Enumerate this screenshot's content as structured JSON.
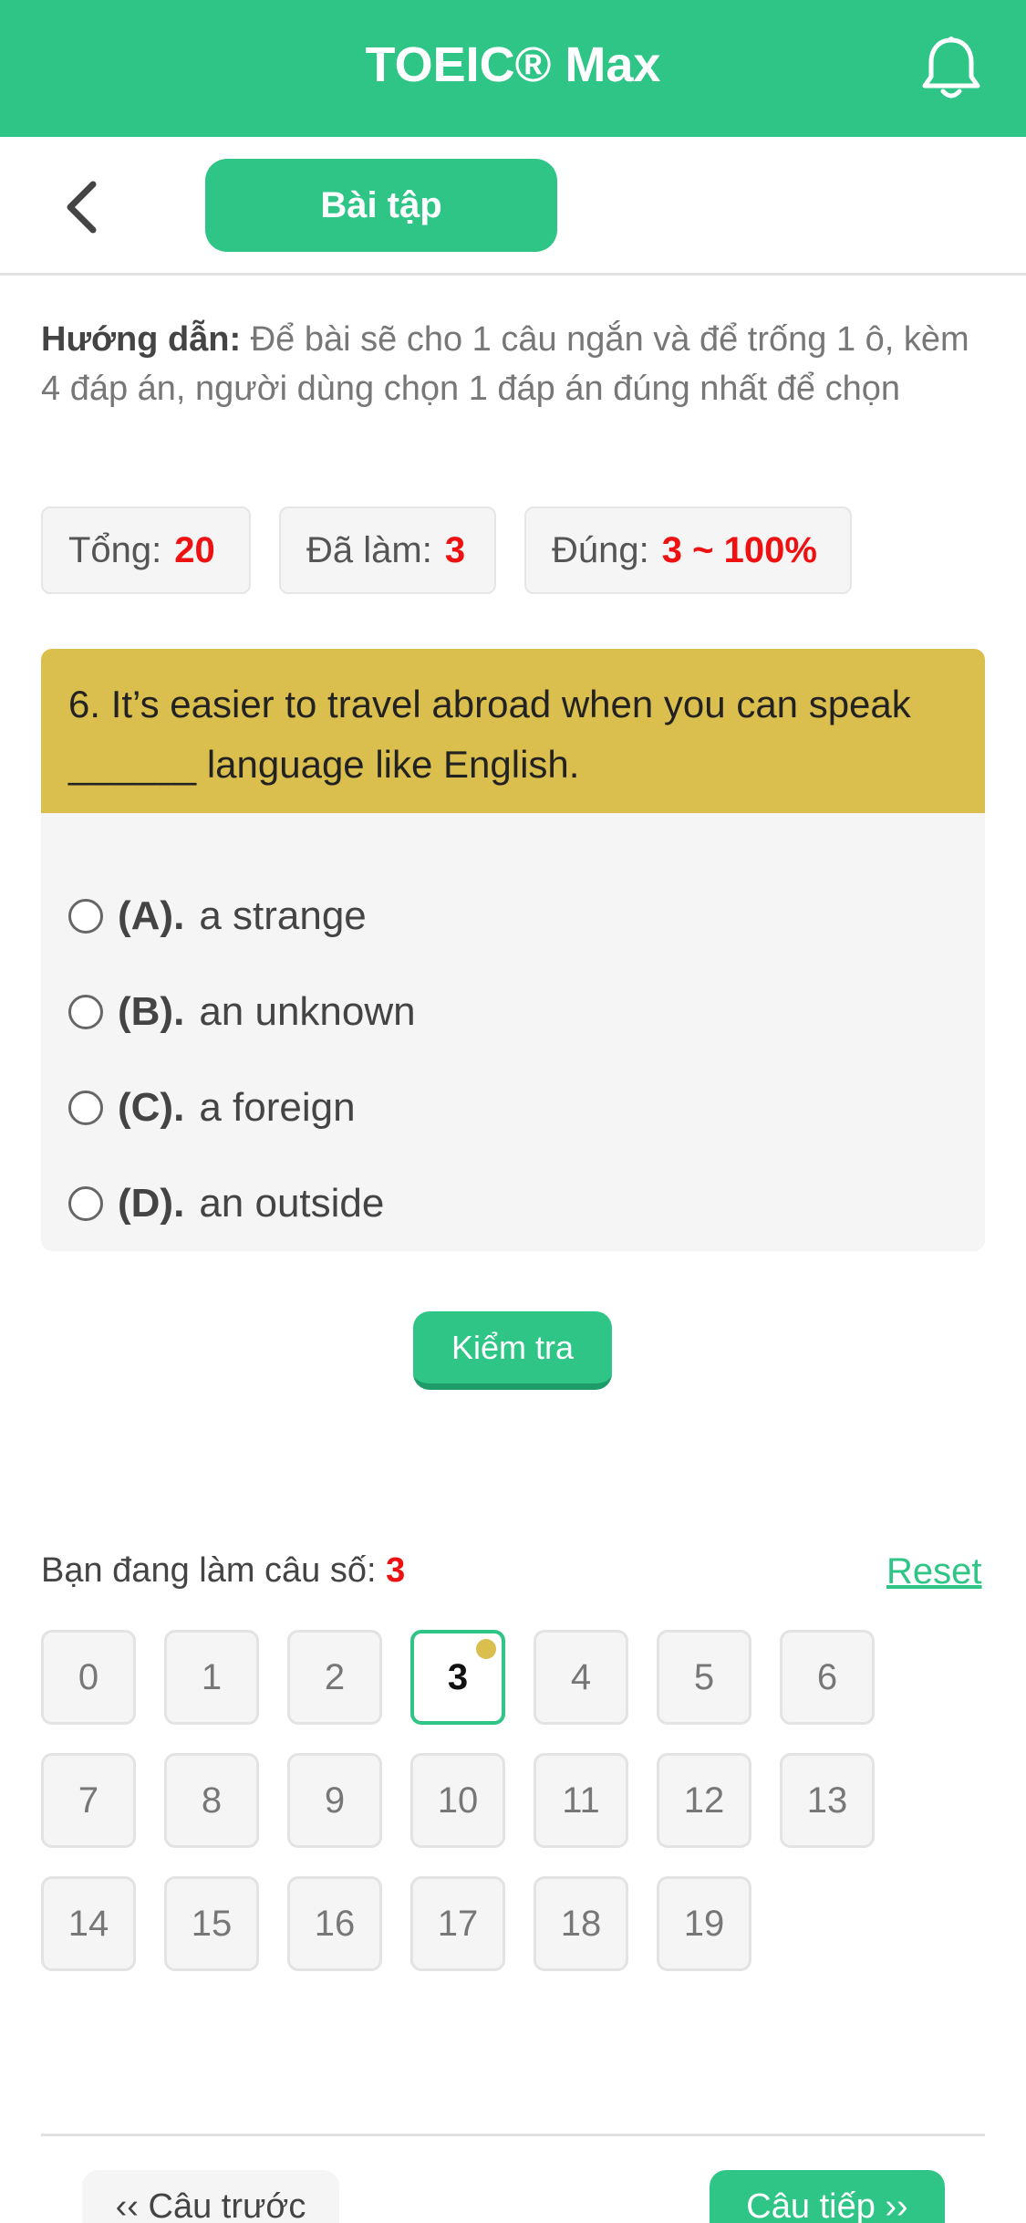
{
  "header": {
    "title": "TOEIC® Max",
    "bell_icon": "bell-icon"
  },
  "subheader": {
    "back_icon": "chevron-left-icon",
    "tab_label": "Bài tập"
  },
  "instructions": {
    "label": "Hướng dẫn:",
    "text": "Để bài sẽ cho 1 câu ngắn và để trống 1 ô, kèm 4 đáp án, người dùng chọn 1 đáp án đúng nhất để chọn"
  },
  "stats": {
    "total_label": "Tổng:",
    "total_value": "20",
    "done_label": "Đã làm:",
    "done_value": "3",
    "correct_label": "Đúng:",
    "correct_value": "3 ~ 100%"
  },
  "question": {
    "text": "6. It’s easier to travel abroad when you can speak ______ language like English.",
    "options": [
      {
        "letter": "(A).",
        "text": "a strange"
      },
      {
        "letter": "(B).",
        "text": "an unknown"
      },
      {
        "letter": "(C).",
        "text": "a foreign"
      },
      {
        "letter": "(D).",
        "text": "an outside"
      }
    ]
  },
  "check_label": "Kiểm tra",
  "progress": {
    "label": "Bạn đang làm câu số:",
    "current": "3",
    "reset_label": "Reset",
    "numbers": [
      "0",
      "1",
      "2",
      "3",
      "4",
      "5",
      "6",
      "7",
      "8",
      "9",
      "10",
      "11",
      "12",
      "13",
      "14",
      "15",
      "16",
      "17",
      "18",
      "19"
    ]
  },
  "nav": {
    "prev_label": "‹‹ Câu trước",
    "next_label": "Câu tiếp ››"
  },
  "colors": {
    "brand": "#2ec587",
    "question_header": "#dbbf4e",
    "highlight": "#e11111"
  }
}
